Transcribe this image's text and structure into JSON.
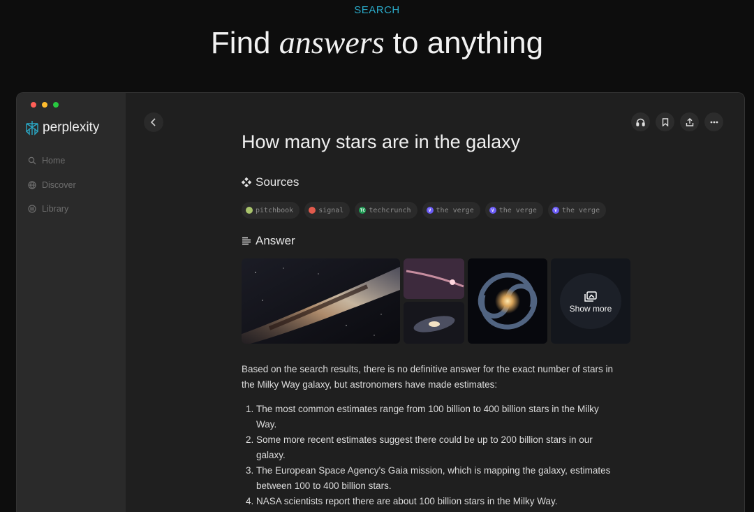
{
  "hero": {
    "eyebrow": "SEARCH",
    "title_before": "Find ",
    "title_accent": "answers",
    "title_after": " to anything"
  },
  "colors": {
    "accent": "#2aa8c6",
    "traffic_red": "#ff5f57",
    "traffic_yellow": "#febc2e",
    "traffic_green": "#28c840"
  },
  "sidebar": {
    "logo_text": "perplexity",
    "items": [
      {
        "label": "Home",
        "icon": "search-icon"
      },
      {
        "label": "Discover",
        "icon": "globe-icon"
      },
      {
        "label": "Library",
        "icon": "library-icon"
      }
    ]
  },
  "toolbar": {
    "back_icon": "chevron-left-icon",
    "actions": [
      "headphones-icon",
      "bookmark-icon",
      "share-icon",
      "more-icon"
    ]
  },
  "thread": {
    "question": "How many stars are in the galaxy",
    "sources_heading": "Sources",
    "answer_heading": "Answer",
    "sources": [
      {
        "name": "pitchbook",
        "color": "#a9c46b"
      },
      {
        "name": "signal",
        "color": "#e25b4d"
      },
      {
        "name": "techcrunch",
        "color": "#1f9d55"
      },
      {
        "name": "the verge",
        "color": "#6b5cf6"
      },
      {
        "name": "the verge",
        "color": "#6b5cf6"
      },
      {
        "name": "the verge",
        "color": "#6b5cf6"
      }
    ],
    "show_more_label": "Show more",
    "answer_intro": "Based on the search results, there is no definitive answer for the exact number of stars in the Milky Way galaxy, but astronomers have made estimates:",
    "answer_points": [
      "The most common estimates range from 100 billion to 400 billion stars in the Milky Way.",
      "Some more recent estimates suggest there could be up to 200 billion stars in our galaxy.",
      "The European Space Agency's Gaia mission, which is mapping the galaxy, estimates between 100 to 400 billion stars.",
      "NASA scientists report there are about 100 billion stars in the Milky Way."
    ]
  }
}
